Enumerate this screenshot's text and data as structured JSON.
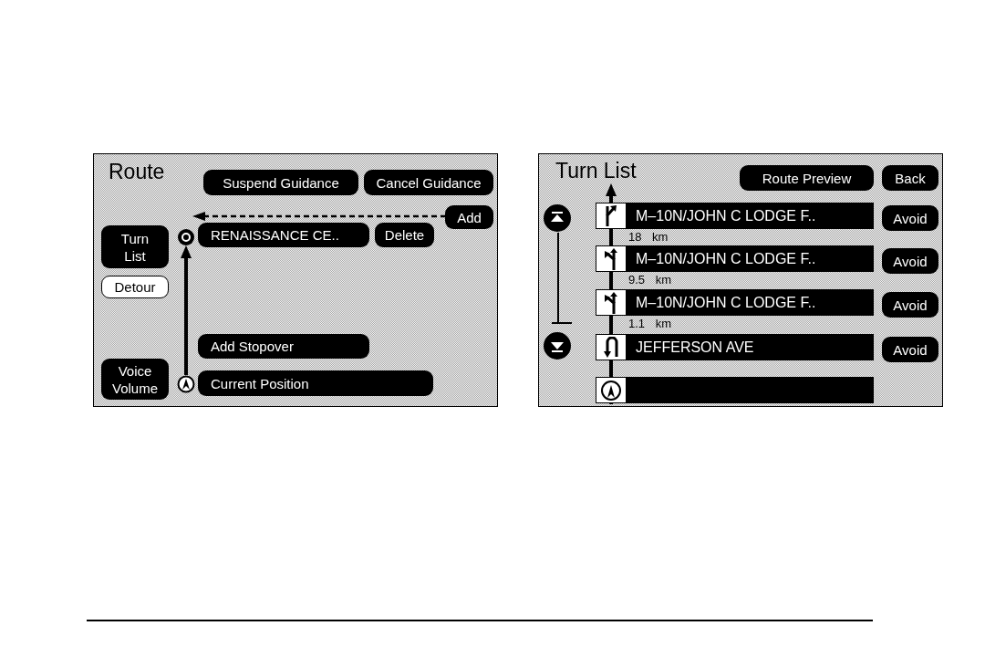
{
  "route_screen": {
    "title": "Route",
    "top_buttons": [
      "Suspend Guidance",
      "Cancel Guidance"
    ],
    "add_button": "Add",
    "side_buttons": [
      {
        "label": "Turn List",
        "kind": "filled"
      },
      {
        "label": "Detour",
        "kind": "outlined"
      },
      {
        "label": "Voice Volume",
        "kind": "filled"
      }
    ],
    "destination": {
      "name": "RENAISSANCE CE..",
      "delete_button": "Delete"
    },
    "add_stopover": "Add Stopover",
    "current_position": "Current Position"
  },
  "turn_list_screen": {
    "title": "Turn List",
    "top_buttons": [
      "Route Preview",
      "Back"
    ],
    "turns": [
      {
        "kind": "keep-right",
        "street": "M–10N/JOHN C LODGE F..",
        "avoid_button": "Avoid",
        "distance": "18 km"
      },
      {
        "kind": "keep-left",
        "street": "M–10N/JOHN C LODGE F..",
        "avoid_button": "Avoid",
        "distance": "9.5 km"
      },
      {
        "kind": "keep-left",
        "street": "M–10N/JOHN C LODGE F..",
        "avoid_button": "Avoid",
        "distance": "1.1 km"
      },
      {
        "kind": "u-turn",
        "street": "JEFFERSON AVE",
        "avoid_button": "Avoid"
      },
      {
        "kind": "start"
      }
    ]
  }
}
